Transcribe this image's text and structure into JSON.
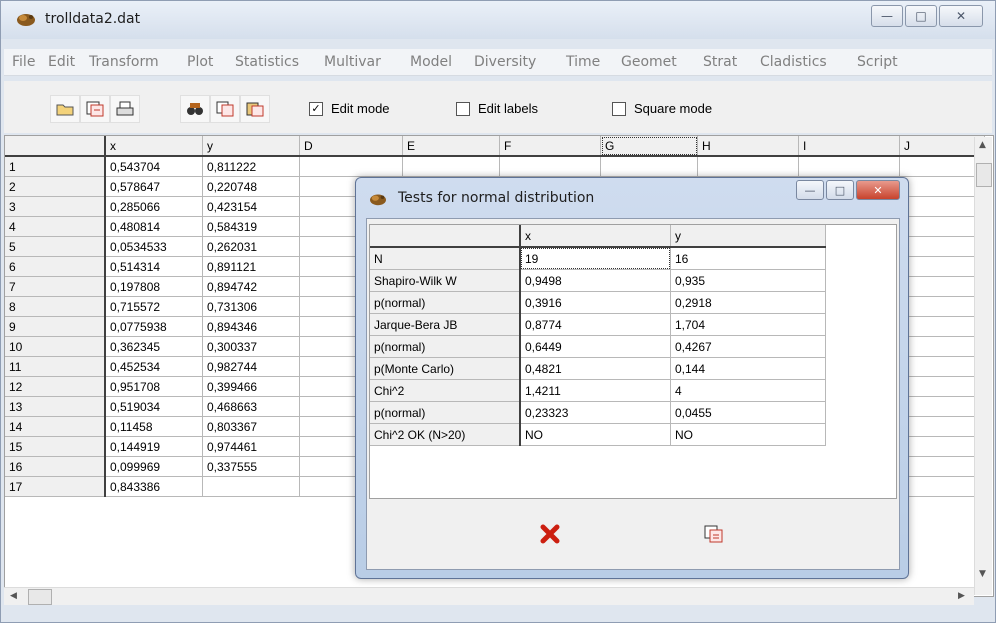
{
  "window": {
    "title": "trolldata2.dat",
    "min": "—",
    "max": "□",
    "close": "✕"
  },
  "menu": [
    "File",
    "Edit",
    "Transform",
    "Plot",
    "Statistics",
    "Multivar",
    "Model",
    "Diversity",
    "Time",
    "Geomet",
    "Strat",
    "Cladistics",
    "Script"
  ],
  "toolbar": {
    "edit_mode": {
      "label": "Edit mode",
      "checked": true
    },
    "edit_labels": {
      "label": "Edit labels",
      "checked": false
    },
    "square_mode": {
      "label": "Square mode",
      "checked": false
    }
  },
  "grid": {
    "columns": [
      "x",
      "y",
      "D",
      "E",
      "F",
      "G",
      "H",
      "I",
      "J"
    ],
    "rows": [
      {
        "n": "1",
        "x": "0,543704",
        "y": "0,811222"
      },
      {
        "n": "2",
        "x": "0,578647",
        "y": "0,220748"
      },
      {
        "n": "3",
        "x": "0,285066",
        "y": "0,423154"
      },
      {
        "n": "4",
        "x": "0,480814",
        "y": "0,584319"
      },
      {
        "n": "5",
        "x": "0,0534533",
        "y": "0,262031"
      },
      {
        "n": "6",
        "x": "0,514314",
        "y": "0,891121"
      },
      {
        "n": "7",
        "x": "0,197808",
        "y": "0,894742"
      },
      {
        "n": "8",
        "x": "0,715572",
        "y": "0,731306"
      },
      {
        "n": "9",
        "x": "0,0775938",
        "y": "0,894346"
      },
      {
        "n": "10",
        "x": "0,362345",
        "y": "0,300337"
      },
      {
        "n": "11",
        "x": "0,452534",
        "y": "0,982744"
      },
      {
        "n": "12",
        "x": "0,951708",
        "y": "0,399466"
      },
      {
        "n": "13",
        "x": "0,519034",
        "y": "0,468663"
      },
      {
        "n": "14",
        "x": "0,11458",
        "y": "0,803367"
      },
      {
        "n": "15",
        "x": "0,144919",
        "y": "0,974461"
      },
      {
        "n": "16",
        "x": "0,099969",
        "y": "0,337555"
      },
      {
        "n": "17",
        "x": "0,843386",
        "y": ""
      }
    ]
  },
  "dialog": {
    "title": "Tests for normal distribution",
    "min": "—",
    "max": "□",
    "close": "✕",
    "columns": [
      "x",
      "y"
    ],
    "rows": [
      {
        "label": "N",
        "x": "19",
        "y": "16"
      },
      {
        "label": "Shapiro-Wilk W",
        "x": "0,9498",
        "y": "0,935"
      },
      {
        "label": "p(normal)",
        "x": "0,3916",
        "y": "0,2918"
      },
      {
        "label": "Jarque-Bera JB",
        "x": "0,8774",
        "y": "1,704"
      },
      {
        "label": "p(normal)",
        "x": "0,6449",
        "y": "0,4267"
      },
      {
        "label": "p(Monte Carlo)",
        "x": "0,4821",
        "y": "0,144"
      },
      {
        "label": "Chi^2",
        "x": "1,4211",
        "y": "4"
      },
      {
        "label": "p(normal)",
        "x": "0,23323",
        "y": "0,0455"
      },
      {
        "label": "Chi^2 OK (N>20)",
        "x": "NO",
        "y": "NO"
      }
    ]
  },
  "colors": {
    "accent_red": "#cc1f10",
    "title_bg": "#dfe6ef"
  }
}
